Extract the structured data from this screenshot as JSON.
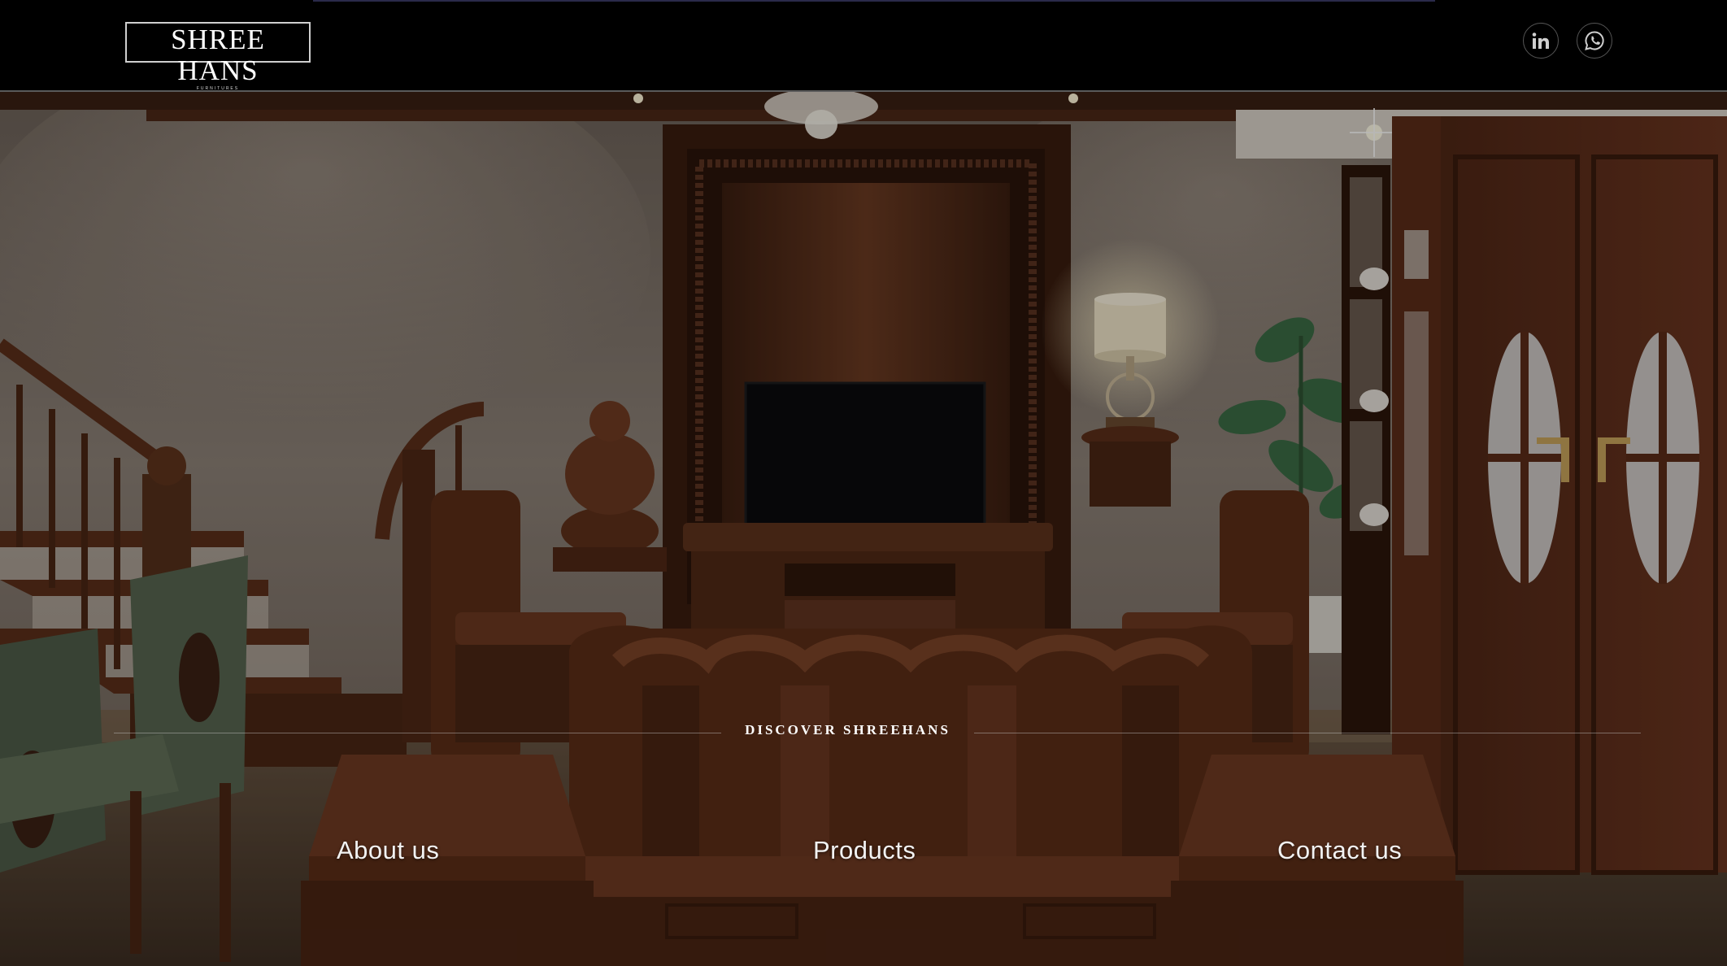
{
  "header": {
    "logo": {
      "main": "SHREE HANS",
      "sub": "FURNITURES"
    },
    "social": [
      {
        "name": "linkedin",
        "icon": "linkedin-icon"
      },
      {
        "name": "whatsapp",
        "icon": "whatsapp-icon"
      }
    ]
  },
  "hero": {
    "discover_label": "DISCOVER SHREEHANS",
    "nav": {
      "about": "About us",
      "products": "Products",
      "contact": "Contact us"
    }
  },
  "colors": {
    "header_bg": "#000000",
    "wood_dark": "#4a2616",
    "wood_mid": "#6e3a22",
    "wall": "#8a7f75",
    "text": "#ffffff"
  }
}
